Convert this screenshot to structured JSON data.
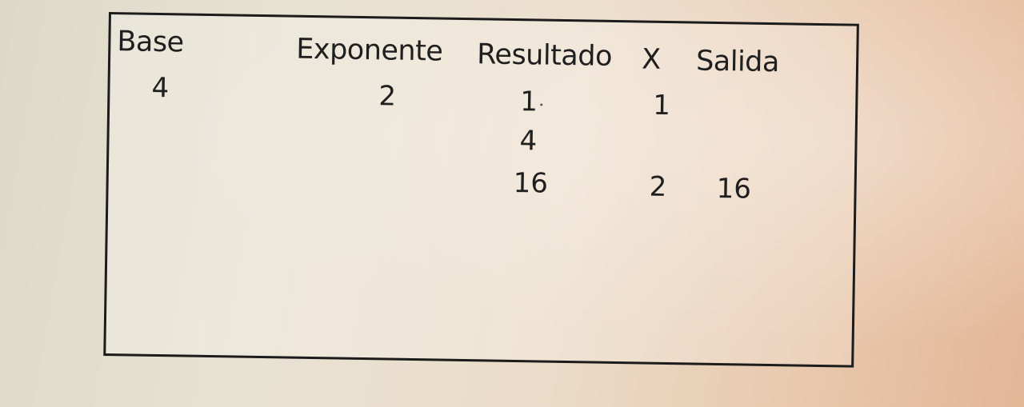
{
  "table": {
    "headers": {
      "base": "Base",
      "exponente": "Exponente",
      "resultado": "Resultado",
      "x": "X",
      "salida": "Salida"
    },
    "rows": [
      {
        "base": "4",
        "exponente": "2",
        "resultado": "1",
        "x": "1",
        "salida": ""
      },
      {
        "base": "",
        "exponente": "",
        "resultado": "4",
        "x": "",
        "salida": ""
      },
      {
        "base": "",
        "exponente": "",
        "resultado": "16",
        "x": "2",
        "salida": "16"
      }
    ]
  },
  "colors": {
    "ink": "#1f1f1f",
    "border": "#1c1c1c"
  }
}
